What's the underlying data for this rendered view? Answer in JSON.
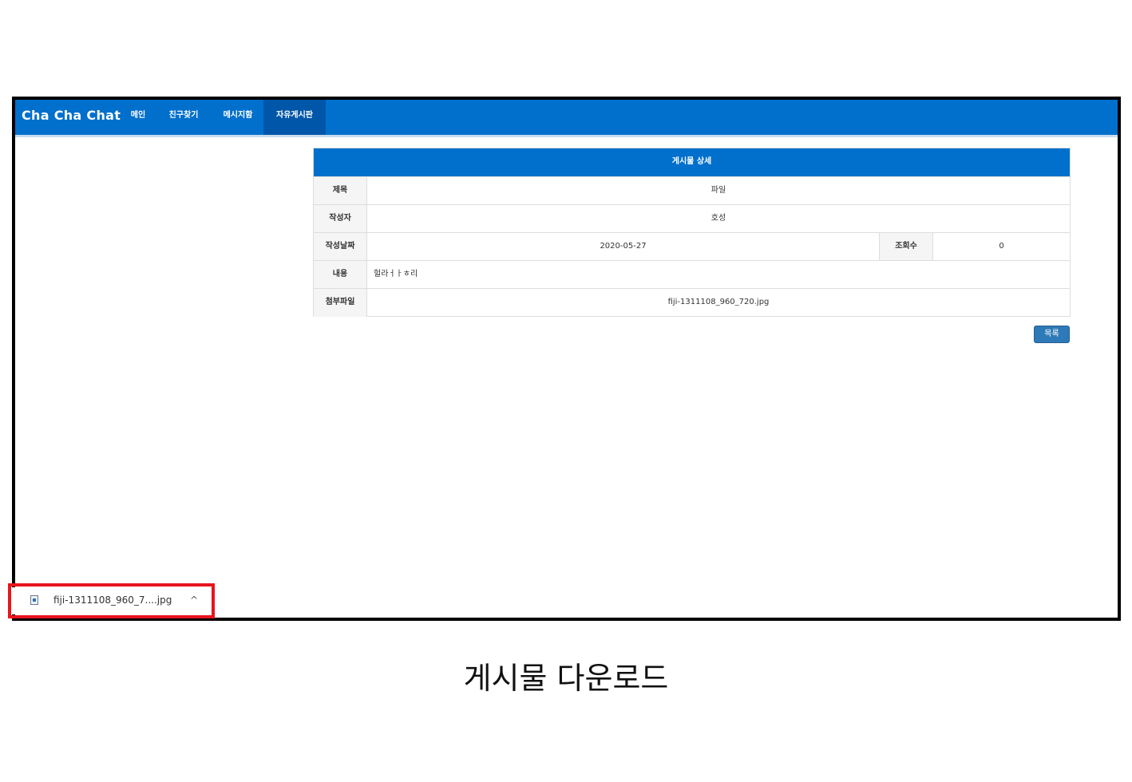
{
  "navbar": {
    "brand": "Cha Cha Chat",
    "items": [
      {
        "label": "메인",
        "active": false
      },
      {
        "label": "친구찾기",
        "active": false
      },
      {
        "label": "메시지함",
        "active": false
      },
      {
        "label": "자유게시판",
        "active": true
      }
    ]
  },
  "post": {
    "header": "게시물 상세",
    "title_label": "제목",
    "title_value": "파일",
    "author_label": "작성자",
    "author_value": "호성",
    "date_label": "작성날짜",
    "date_value": "2020-05-27",
    "views_label": "조회수",
    "views_value": "0",
    "content_label": "내용",
    "content_value": "헐라ㅓㅏㅎ리",
    "attach_label": "첨부파일",
    "attach_value": "fiji-1311108_960_720.jpg"
  },
  "list_button": "목록",
  "download_bar": {
    "filename": "fiji-1311108_960_7....jpg",
    "icon": "image-file-icon",
    "chevron": "^"
  },
  "highlight_color": "#e8141c",
  "caption": "게시물 다운로드"
}
